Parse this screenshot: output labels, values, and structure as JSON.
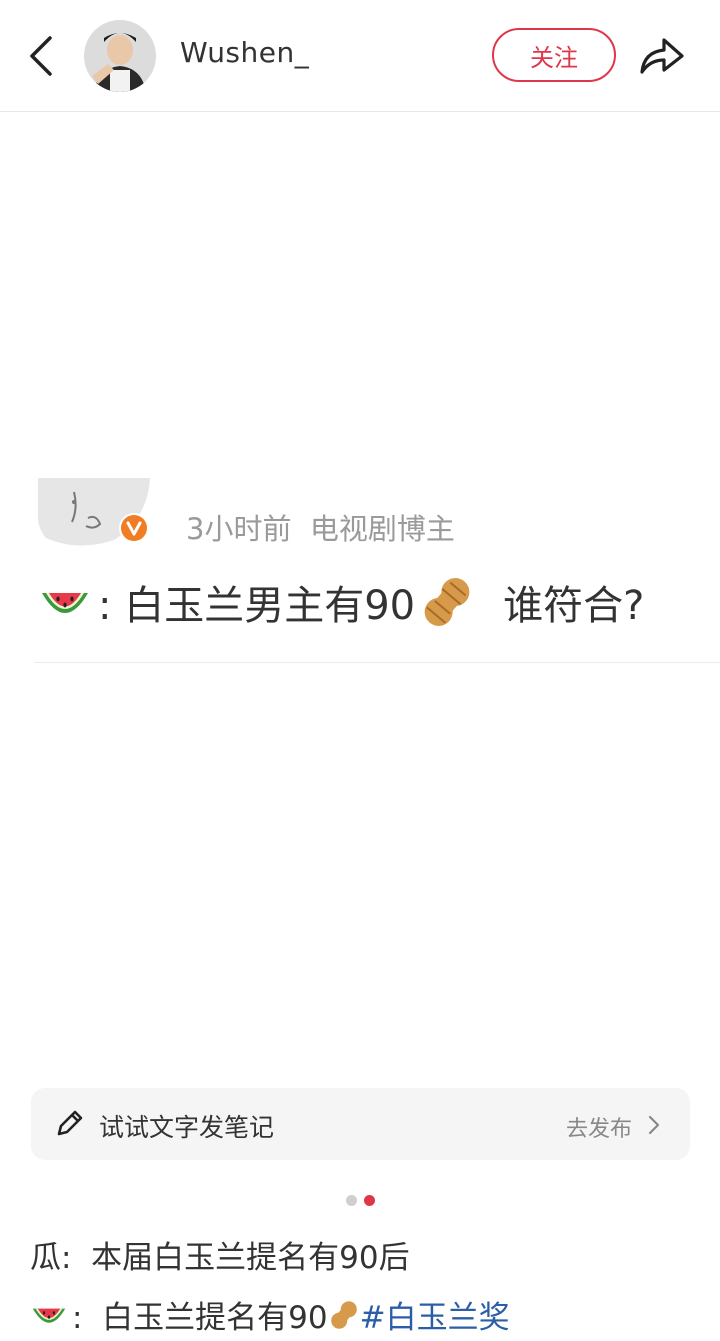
{
  "header": {
    "username": "Wushen_",
    "follow_label": "关注"
  },
  "post_card": {
    "meta": "3小时前  电视剧博主",
    "text": ": 白玉兰男主有90",
    "text_tail": "谁符合?"
  },
  "prompt_bar": {
    "label": "试试文字发笔记",
    "action": "去发布"
  },
  "pagination": {
    "current": 2,
    "total": 2
  },
  "caption": {
    "line1": "瓜:  本届白玉兰提名有90后",
    "line2_prefix": ":  白玉兰提名有90",
    "hashtag": "#白玉兰奖"
  },
  "colors": {
    "accent": "#e0364a",
    "hashtag": "#2b5ea7"
  }
}
